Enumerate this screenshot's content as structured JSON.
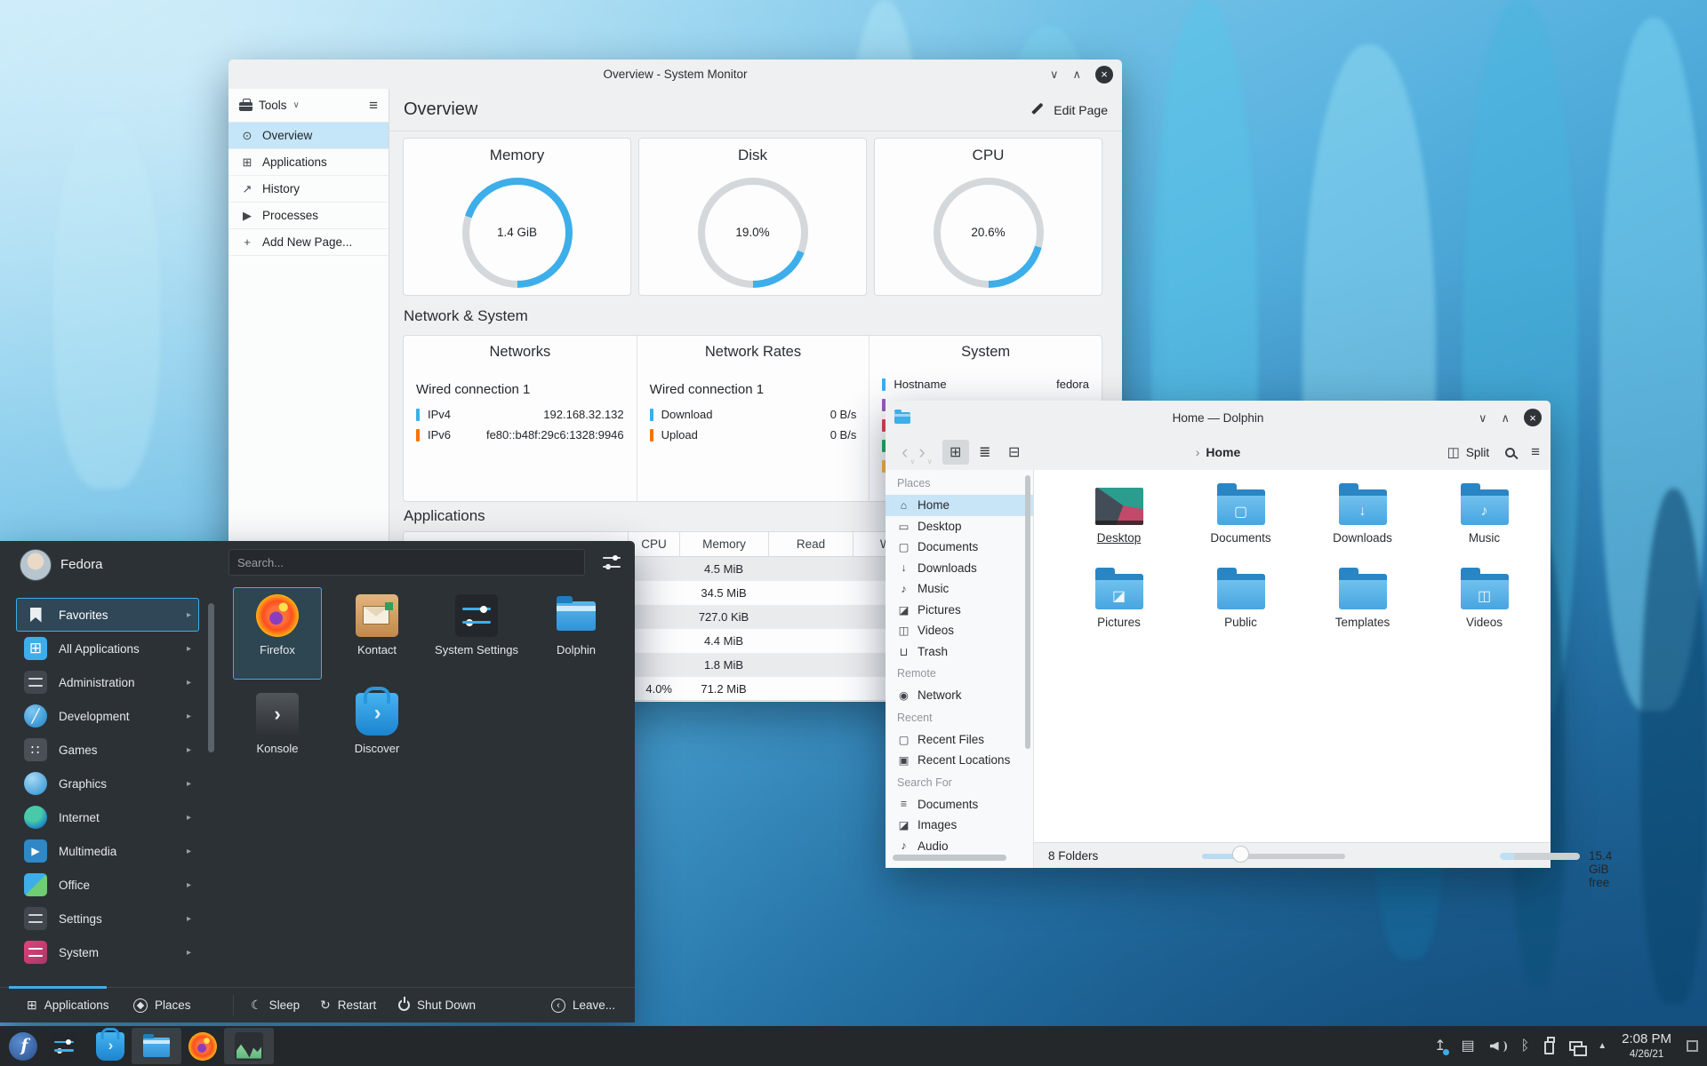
{
  "glyphs": {
    "minimize": "∨",
    "maximize": "∧",
    "close": "×",
    "chevron_down": "∨",
    "chevron_right": "›",
    "chevron_left": "‹",
    "arrow_small": "▸",
    "hamburger": "≡",
    "grid": "⊞",
    "compact": "≣",
    "tree": "⊟",
    "split": "◫",
    "up_triangle": "▲",
    "bluetooth": "ᛒ",
    "clipboard": "▤",
    "update": "↥",
    "konsole_prompt": "❯",
    "sleep": "☾",
    "restart": "↻",
    "multimedia_play": "▶",
    "games_dots": "∷",
    "dev_slash": "╱"
  },
  "system_monitor": {
    "window_title": "Overview - System Monitor",
    "tools_label": "Tools",
    "page_title": "Overview",
    "edit_page_label": "Edit Page",
    "sidebar_items": [
      {
        "label": "Overview",
        "glyph": "⊙",
        "selected": true
      },
      {
        "label": "Applications",
        "glyph": "⊞"
      },
      {
        "label": "History",
        "glyph": "↗"
      },
      {
        "label": "Processes",
        "glyph": "▶"
      },
      {
        "label": "Add New Page...",
        "glyph": "+"
      }
    ],
    "gauges": [
      {
        "title": "Memory",
        "value": "1.4 GiB",
        "percent": "70"
      },
      {
        "title": "Disk",
        "value": "19.0%",
        "percent": "19"
      },
      {
        "title": "CPU",
        "value": "20.6%",
        "percent": "20.6"
      }
    ],
    "network_system": {
      "section_title": "Network & System",
      "networks": {
        "header": "Networks",
        "connection": "Wired connection 1",
        "rows": [
          {
            "label": "IPv4",
            "value": "192.168.32.132",
            "color": "#3daee9"
          },
          {
            "label": "IPv6",
            "value": "fe80::b48f:29c6:1328:9946",
            "color": "#f67400"
          }
        ]
      },
      "rates": {
        "header": "Network Rates",
        "connection": "Wired connection 1",
        "rows": [
          {
            "label": "Download",
            "value": "0 B/s",
            "color": "#3daee9"
          },
          {
            "label": "Upload",
            "value": "0 B/s",
            "color": "#f67400"
          }
        ]
      },
      "system": {
        "header": "System",
        "rows": [
          {
            "label": "Hostname",
            "value": "fedora",
            "color": "#3daee9"
          }
        ],
        "partial_row_colors": [
          "#9b59b6",
          "#da4453",
          "#27ae60",
          "#fdbc4b"
        ]
      }
    },
    "applications": {
      "section_title": "Applications",
      "columns": [
        "CPU",
        "Memory",
        "Read",
        "Write"
      ],
      "rows": [
        {
          "cpu": "",
          "memory": "4.5 MiB",
          "read": "",
          "write": ""
        },
        {
          "cpu": "",
          "memory": "34.5 MiB",
          "read": "",
          "write": ""
        },
        {
          "cpu": "",
          "memory": "727.0 KiB",
          "read": "",
          "write": ""
        },
        {
          "cpu": "",
          "memory": "4.4 MiB",
          "read": "",
          "write": ""
        },
        {
          "cpu": "",
          "memory": "1.8 MiB",
          "read": "",
          "write": ""
        },
        {
          "cpu": "4.0%",
          "memory": "71.2 MiB",
          "read": "",
          "write": ""
        }
      ]
    }
  },
  "dolphin": {
    "window_title": "Home — Dolphin",
    "breadcrumb": "Home",
    "split_label": "Split",
    "places": {
      "sections": [
        {
          "title": "Places",
          "items": [
            {
              "label": "Home",
              "glyph": "⌂",
              "selected": true
            },
            {
              "label": "Desktop",
              "glyph": "▭"
            },
            {
              "label": "Documents",
              "glyph": "▢"
            },
            {
              "label": "Downloads",
              "glyph": "↓"
            },
            {
              "label": "Music",
              "glyph": "♪"
            },
            {
              "label": "Pictures",
              "glyph": "◪"
            },
            {
              "label": "Videos",
              "glyph": "◫"
            },
            {
              "label": "Trash",
              "glyph": "⊔"
            }
          ]
        },
        {
          "title": "Remote",
          "items": [
            {
              "label": "Network",
              "glyph": "◉"
            }
          ]
        },
        {
          "title": "Recent",
          "items": [
            {
              "label": "Recent Files",
              "glyph": "▢"
            },
            {
              "label": "Recent Locations",
              "glyph": "▣"
            }
          ]
        },
        {
          "title": "Search For",
          "items": [
            {
              "label": "Documents",
              "glyph": "≡"
            },
            {
              "label": "Images",
              "glyph": "◪"
            },
            {
              "label": "Audio",
              "glyph": "♪"
            }
          ]
        }
      ]
    },
    "folders": [
      {
        "name": "Desktop",
        "emblem": ""
      },
      {
        "name": "Documents",
        "emblem": "▢"
      },
      {
        "name": "Downloads",
        "emblem": "↓"
      },
      {
        "name": "Music",
        "emblem": "♪"
      },
      {
        "name": "Pictures",
        "emblem": "◪"
      },
      {
        "name": "Public",
        "emblem": ""
      },
      {
        "name": "Templates",
        "emblem": ""
      },
      {
        "name": "Videos",
        "emblem": "◫"
      }
    ],
    "status_left": "8 Folders",
    "status_right": "15.4 GiB free"
  },
  "launcher": {
    "user_name": "Fedora",
    "search_placeholder": "Search...",
    "categories": [
      {
        "label": "Favorites",
        "selected": true
      },
      {
        "label": "All Applications"
      },
      {
        "label": "Administration"
      },
      {
        "label": "Development"
      },
      {
        "label": "Games"
      },
      {
        "label": "Graphics"
      },
      {
        "label": "Internet"
      },
      {
        "label": "Multimedia"
      },
      {
        "label": "Office"
      },
      {
        "label": "Settings"
      },
      {
        "label": "System"
      }
    ],
    "favorites": [
      {
        "label": "Firefox",
        "selected": true
      },
      {
        "label": "Kontact"
      },
      {
        "label": "System Settings"
      },
      {
        "label": "Dolphin"
      },
      {
        "label": "Konsole"
      },
      {
        "label": "Discover"
      }
    ],
    "footer": {
      "tab_applications": "Applications",
      "tab_places": "Places",
      "sleep": "Sleep",
      "restart": "Restart",
      "shutdown": "Shut Down",
      "leave": "Leave..."
    }
  },
  "panel": {
    "clock_time": "2:08 PM",
    "clock_date": "4/26/21"
  }
}
